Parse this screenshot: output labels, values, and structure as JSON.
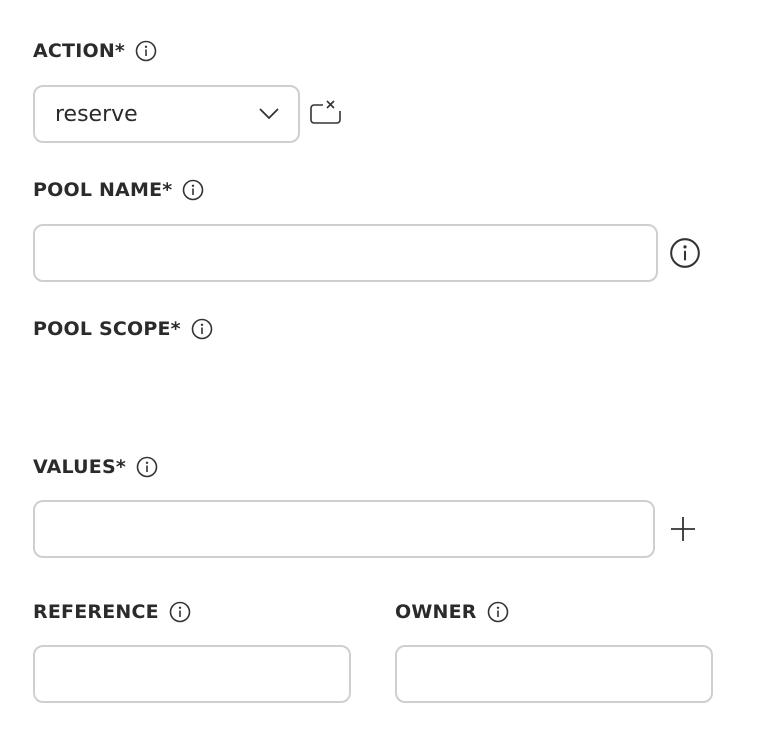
{
  "action": {
    "label": "ACTION*",
    "selected_value": "reserve"
  },
  "pool_name": {
    "label": "POOL NAME*",
    "value": "",
    "placeholder": ""
  },
  "pool_scope": {
    "label": "POOL SCOPE*"
  },
  "values": {
    "label": "VALUES*",
    "value": "",
    "placeholder": ""
  },
  "reference": {
    "label": "REFERENCE",
    "value": "",
    "placeholder": ""
  },
  "owner": {
    "label": "OWNER",
    "value": "",
    "placeholder": ""
  },
  "icons": {
    "info": "info-icon",
    "clear": "clear-selection-icon",
    "chevron": "chevron-down-icon",
    "add": "plus-icon"
  },
  "colors": {
    "border": "#cfcfcf",
    "label_text": "#2b2b2b",
    "icon": "#333333"
  }
}
